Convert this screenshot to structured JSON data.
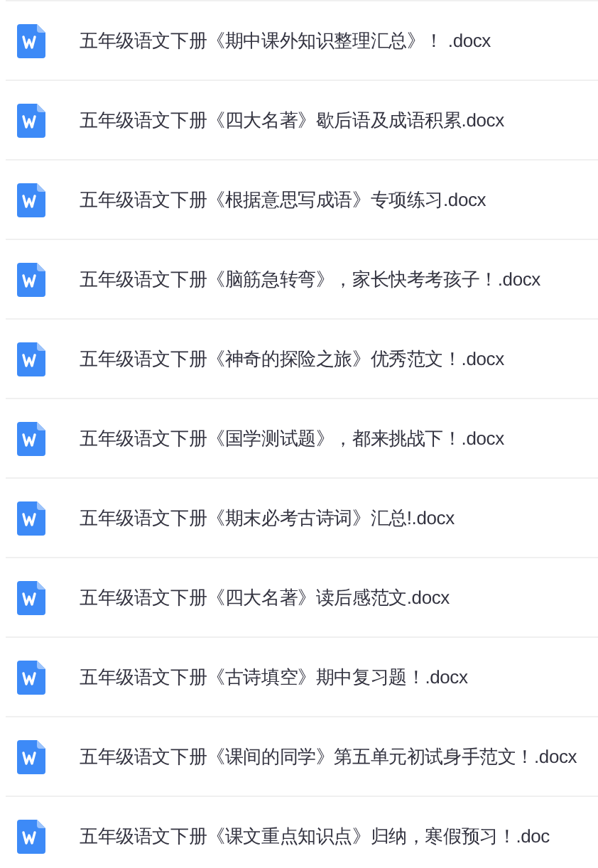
{
  "files": [
    {
      "name": "五年级语文下册《期中课外知识整理汇总》！ .docx"
    },
    {
      "name": "五年级语文下册《四大名著》歇后语及成语积累.docx"
    },
    {
      "name": "五年级语文下册《根据意思写成语》专项练习.docx"
    },
    {
      "name": "五年级语文下册《脑筋急转弯》，家长快考考孩子！.docx"
    },
    {
      "name": "五年级语文下册《神奇的探险之旅》优秀范文！.docx"
    },
    {
      "name": "五年级语文下册《国学测试题》，都来挑战下！.docx"
    },
    {
      "name": "五年级语文下册《期末必考古诗词》汇总!.docx"
    },
    {
      "name": "五年级语文下册《四大名著》读后感范文.docx"
    },
    {
      "name": "五年级语文下册《古诗填空》期中复习题！.docx"
    },
    {
      "name": "五年级语文下册《课间的同学》第五单元初试身手范文！.docx"
    },
    {
      "name": "五年级语文下册《课文重点知识点》归纳，寒假预习！.doc"
    }
  ]
}
